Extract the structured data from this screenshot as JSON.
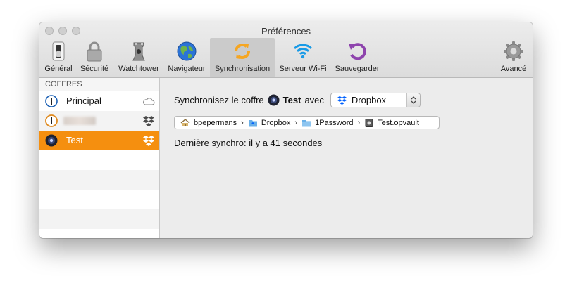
{
  "window": {
    "title": "Préférences"
  },
  "toolbar": {
    "items": [
      {
        "label": "Général",
        "icon": "general-switch-icon"
      },
      {
        "label": "Sécurité",
        "icon": "padlock-icon"
      },
      {
        "label": "Watchtower",
        "icon": "watchtower-icon"
      },
      {
        "label": "Navigateur",
        "icon": "globe-icon"
      },
      {
        "label": "Synchronisation",
        "icon": "sync-arrows-icon",
        "selected": true
      },
      {
        "label": "Serveur Wi-Fi",
        "icon": "wifi-icon"
      },
      {
        "label": "Sauvegarder",
        "icon": "backup-arrow-icon"
      },
      {
        "label": "Avancé",
        "icon": "gear-icon"
      }
    ]
  },
  "sidebar": {
    "header": "COFFRES",
    "vaults": [
      {
        "name": "Principal",
        "sync": "cloud-icon"
      },
      {
        "name": "",
        "sync": "dropbox-icon"
      },
      {
        "name": "Test",
        "sync": "dropbox-icon",
        "selected": true
      }
    ]
  },
  "main": {
    "sync_prefix": "Synchronisez le coffre",
    "vault_name": "Test",
    "sync_suffix": "avec",
    "service": "Dropbox",
    "path": [
      "bpepermans",
      "Dropbox",
      "1Password",
      "Test.opvault"
    ],
    "last_sync": "Dernière synchro: il y a 41 secondes"
  },
  "colors": {
    "selection": "#f58f0f",
    "sync_icon": "#f5a623",
    "wifi": "#1a9be6",
    "backup": "#8e44ad",
    "dropbox": "#0061fe"
  }
}
